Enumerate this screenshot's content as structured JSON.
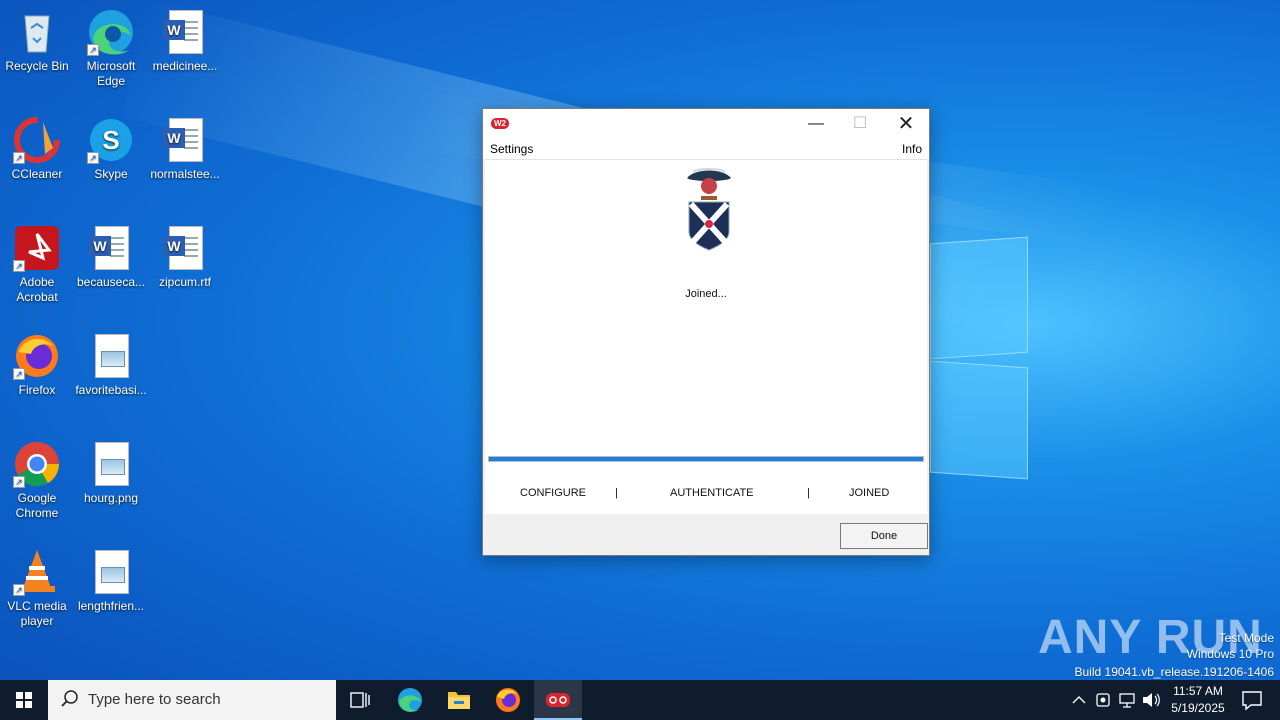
{
  "desktop": {
    "icons": [
      {
        "label": "Recycle Bin"
      },
      {
        "label": "Microsoft Edge"
      },
      {
        "label": "medicinee..."
      },
      {
        "label": "CCleaner"
      },
      {
        "label": "Skype"
      },
      {
        "label": "normalstee..."
      },
      {
        "label": "Adobe Acrobat"
      },
      {
        "label": "becauseca..."
      },
      {
        "label": "zipcum.rtf"
      },
      {
        "label": "Firefox"
      },
      {
        "label": "favoritebasi..."
      },
      {
        "label": "Google Chrome"
      },
      {
        "label": "hourg.png"
      },
      {
        "label": "VLC media player"
      },
      {
        "label": "lengthfrien..."
      }
    ]
  },
  "dialog": {
    "app_icon_text": "W2",
    "menu_left": "Settings",
    "menu_right": "Info",
    "status_text": "Joined...",
    "steps": [
      "CONFIGURE",
      "|",
      "AUTHENTICATE",
      "|",
      "JOINED"
    ],
    "progress": 1.0,
    "done_label": "Done",
    "accent_color": "#1e7de0"
  },
  "watermark": {
    "logo_text": "ANY RUN",
    "line1": "Test Mode",
    "line2": "Windows 10 Pro",
    "line3": "Build 19041.vb_release.191206-1406"
  },
  "taskbar": {
    "search_placeholder": "Type here to search",
    "time": "11:57 AM",
    "date": "5/19/2025"
  }
}
